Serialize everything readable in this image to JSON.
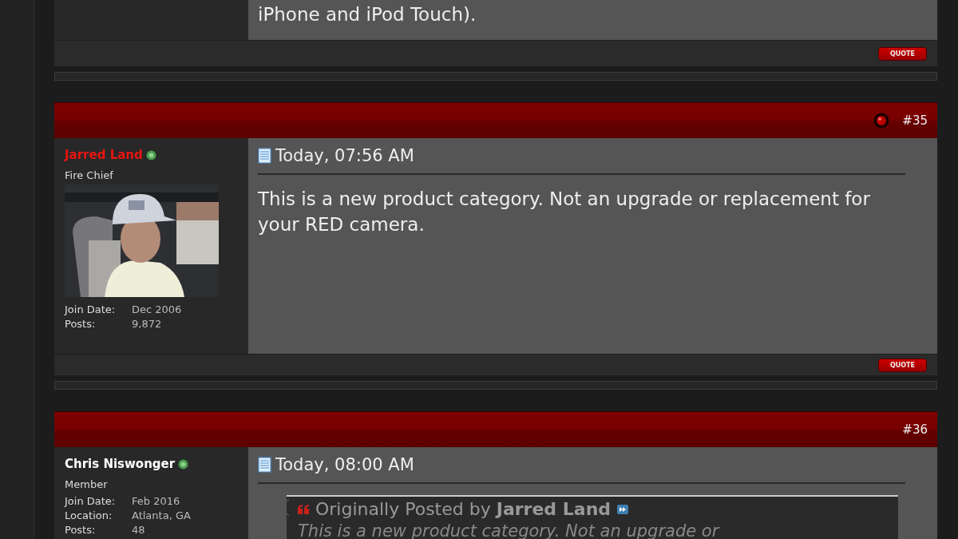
{
  "posts": [
    {
      "body": "iPhone and iPod Touch).",
      "quote_button": "QUOTE"
    },
    {
      "number": "#35",
      "flagged": true,
      "user": {
        "name": "Jarred Land",
        "color": "#e8150f",
        "online": true,
        "rank": "Fire Chief",
        "info": [
          {
            "label": "Join Date:",
            "value": "Dec 2006"
          },
          {
            "label": "Posts:",
            "value": "9,872"
          }
        ]
      },
      "date": "Today, 07:56 AM",
      "body": "This is a new product category. Not an upgrade or replacement for your RED camera.",
      "quote_button": "QUOTE"
    },
    {
      "number": "#36",
      "user": {
        "name": "Chris Niswonger",
        "color": "#ffffff",
        "online": true,
        "rank": "Member",
        "info": [
          {
            "label": "Join Date:",
            "value": "Feb 2016"
          },
          {
            "label": "Location:",
            "value": "Atlanta, GA"
          },
          {
            "label": "Posts:",
            "value": "48"
          }
        ]
      },
      "date": "Today, 08:00 AM",
      "quote": {
        "prefix": "Originally Posted by",
        "author": "Jarred Land",
        "text": "This is a new product category. Not an upgrade or"
      }
    }
  ]
}
